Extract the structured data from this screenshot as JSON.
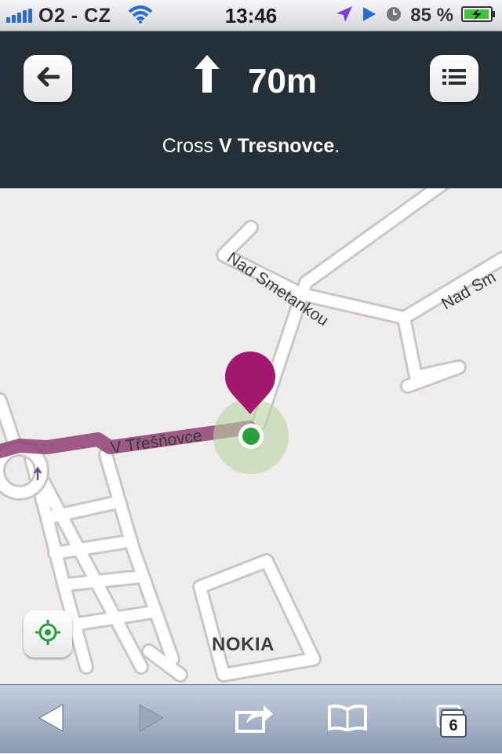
{
  "status_bar": {
    "carrier": "O2 - CZ",
    "time": "13:46",
    "battery_percent": "85 %",
    "icons": [
      "signal-bars-icon",
      "wifi-icon",
      "location-arrow-icon",
      "play-icon",
      "clock-icon",
      "battery-charging-icon"
    ]
  },
  "navigation": {
    "distance": "70m",
    "turn_icon": "straight-arrow-icon",
    "instruction_prefix": "Cross ",
    "instruction_street": "V Tresnovce",
    "instruction_suffix": "."
  },
  "map": {
    "labels": {
      "street_1": "V Třešňovce",
      "street_2": "Nad Smetankou",
      "street_3": "Nad Sm"
    },
    "brand": "NOKIA",
    "route_color": "#8e3f73",
    "pin_color": "#a3186f",
    "position_color": "#2aa03a"
  },
  "toolbar": {
    "tab_count": "6",
    "icons": [
      "back-icon",
      "forward-icon",
      "share-icon",
      "bookmarks-icon",
      "tabs-icon"
    ]
  }
}
